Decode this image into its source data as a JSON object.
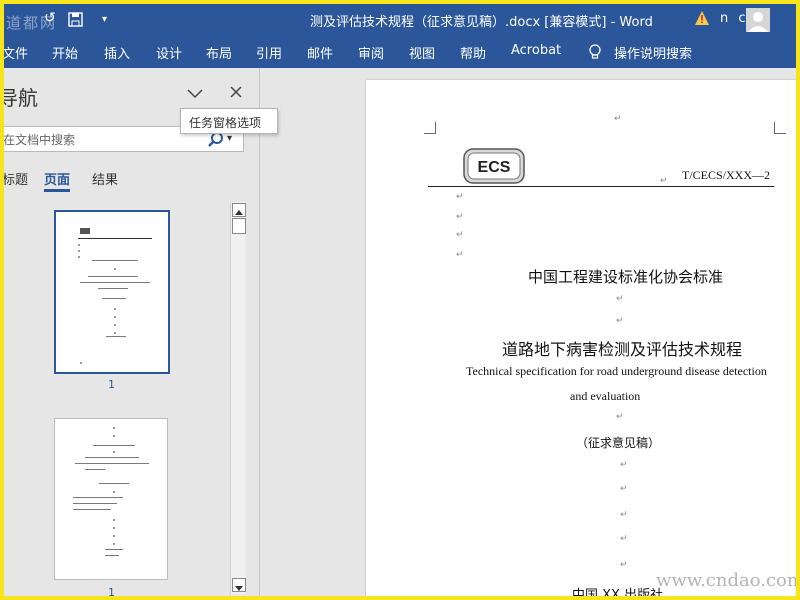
{
  "window": {
    "title": "测及评估技术规程（征求意见稿）.docx [兼容模式]  -  Word",
    "user_initials": "n c"
  },
  "watermarks": {
    "top_left": "道都网",
    "bottom_right": "www.cndao.com"
  },
  "ribbon": {
    "tabs": [
      "文件",
      "开始",
      "插入",
      "设计",
      "布局",
      "引用",
      "邮件",
      "审阅",
      "视图",
      "帮助",
      "Acrobat"
    ],
    "tell_me": "操作说明搜索"
  },
  "nav_pane": {
    "title": "导航",
    "search_placeholder": "在文档中搜索",
    "tooltip": "任务窗格选项",
    "tabs": [
      "标题",
      "页面",
      "结果"
    ],
    "active_tab": "页面",
    "page_numbers": [
      "1",
      "1"
    ]
  },
  "document": {
    "code": "T/CECS/XXX—2",
    "logo_text": "ECS",
    "org": "中国工程建设标准化协会标准",
    "title_cn": "道路地下病害检测及评估技术规程",
    "title_en_line1": "Technical specification for road underground disease detection",
    "title_en_line2": "and evaluation",
    "draft": "（征求意见稿）",
    "publisher": "中国  XX  出版社",
    "para_mark": "↵"
  },
  "colors": {
    "ribbon": "#2b579a",
    "nav_bg": "#e6e6e6",
    "highlight_frame": "#f5e51a"
  }
}
